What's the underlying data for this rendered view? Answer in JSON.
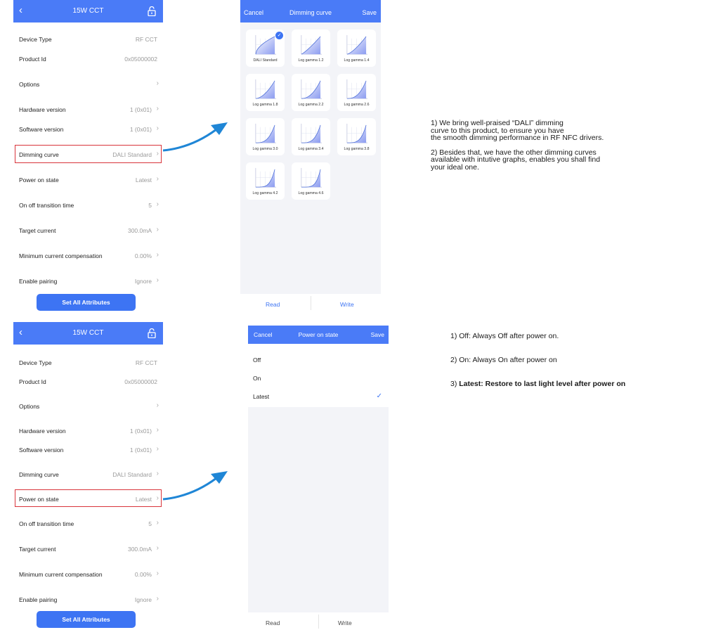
{
  "settings_screen": {
    "title": "15W CCT",
    "back_icon": "chevron-left-icon",
    "lock_icon": "unlock-icon",
    "rows": [
      {
        "label": "Device Type",
        "value": "RF CCT"
      },
      {
        "label": "Product Id",
        "value": "0x05000002"
      },
      {
        "label": "Options",
        "value": ""
      },
      {
        "label": "Hardware version",
        "value": "1 (0x01)"
      },
      {
        "label": "Software version",
        "value": "1 (0x01)"
      },
      {
        "label": "Dimming curve",
        "value": "DALI Standard"
      },
      {
        "label": "Power on state",
        "value": "Latest"
      },
      {
        "label": "On off transition time",
        "value": "5"
      },
      {
        "label": "Target current",
        "value": "300.0mA"
      },
      {
        "label": "Minimum current compensation",
        "value": "0.00%"
      },
      {
        "label": "Enable pairing",
        "value": "Ignore"
      }
    ],
    "button_label": "Set All Attributes",
    "highlight_color": "#d9343b",
    "accent_color": "#3d74f3"
  },
  "dimming_curve_screen": {
    "cancel": "Cancel",
    "title": "Dimming curve",
    "save": "Save",
    "curves": [
      {
        "label": "DALI Standard",
        "selected": true
      },
      {
        "label": "Log gamma 1.2",
        "selected": false
      },
      {
        "label": "Log gamma 1.4",
        "selected": false
      },
      {
        "label": "Log gamma 1.8",
        "selected": false
      },
      {
        "label": "Log gamma 2.2",
        "selected": false
      },
      {
        "label": "Log gamma 2.6",
        "selected": false
      },
      {
        "label": "Log gamma 3.0",
        "selected": false
      },
      {
        "label": "Log gamma 3.4",
        "selected": false
      },
      {
        "label": "Log gamma 3.8",
        "selected": false
      },
      {
        "label": "Log gamma 4.2",
        "selected": false
      },
      {
        "label": "Log gamma 4.6",
        "selected": false
      }
    ],
    "check_icon": "checkmark-icon",
    "read": "Read",
    "write": "Write"
  },
  "power_on_state_screen": {
    "cancel": "Cancel",
    "title": "Power on state",
    "save": "Save",
    "options": [
      "Off",
      "On",
      "Latest"
    ],
    "selected": "Latest",
    "check_icon": "checkmark-icon",
    "read": "Read",
    "write": "Write"
  },
  "descriptions": {
    "dimming": {
      "line1": "1) We bring well-praised “DALI” dimming",
      "line2": "curve to this product, to ensure you have",
      "line3": "the smooth dimming performance in RF NFC drivers.",
      "line4": "2) Besides that, we have the other dimming curves",
      "line5": "available with intutive graphs, enables you shall find",
      "line6": "your ideal one."
    },
    "power": {
      "item1": "1) Off: Always Off after power on.",
      "item2": "2) On: Always On after power on",
      "item3_prefix": "3) ",
      "item3_bold": "Latest: Restore to last light level after power on"
    }
  },
  "arrow_icon": "curved-arrow-icon",
  "arrow_color": "#1f86d6"
}
